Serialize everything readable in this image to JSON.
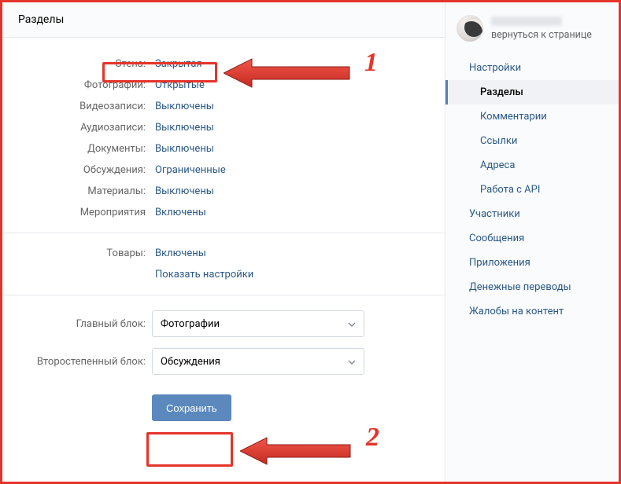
{
  "header": {
    "title": "Разделы"
  },
  "sections1": [
    {
      "label": "Стена:",
      "value": "Закрытая"
    },
    {
      "label": "Фотографии:",
      "value": "Открытые"
    },
    {
      "label": "Видеозаписи:",
      "value": "Выключены"
    },
    {
      "label": "Аудиозаписи:",
      "value": "Выключены"
    },
    {
      "label": "Документы:",
      "value": "Выключены"
    },
    {
      "label": "Обсуждения:",
      "value": "Ограниченные"
    },
    {
      "label": "Материалы:",
      "value": "Выключены"
    },
    {
      "label": "Мероприятия",
      "value": "Включены"
    }
  ],
  "sections2": {
    "goods": {
      "label": "Товары:",
      "value": "Включены"
    },
    "showSettings": "Показать настройки"
  },
  "blocks": {
    "main": {
      "label": "Главный блок:",
      "value": "Фотографии"
    },
    "secondary": {
      "label": "Второстепенный блок:",
      "value": "Обсуждения"
    }
  },
  "saveLabel": "Сохранить",
  "profile": {
    "backLink": "вернуться к странице"
  },
  "menu": [
    {
      "label": "Настройки",
      "sub": false,
      "active": false
    },
    {
      "label": "Разделы",
      "sub": true,
      "active": true
    },
    {
      "label": "Комментарии",
      "sub": true,
      "active": false
    },
    {
      "label": "Ссылки",
      "sub": true,
      "active": false
    },
    {
      "label": "Адреса",
      "sub": true,
      "active": false
    },
    {
      "label": "Работа с API",
      "sub": true,
      "active": false
    },
    {
      "label": "Участники",
      "sub": false,
      "active": false
    },
    {
      "label": "Сообщения",
      "sub": false,
      "active": false
    },
    {
      "label": "Приложения",
      "sub": false,
      "active": false
    },
    {
      "label": "Денежные переводы",
      "sub": false,
      "active": false
    },
    {
      "label": "Жалобы на контент",
      "sub": false,
      "active": false
    }
  ],
  "anno": {
    "num1": "1",
    "num2": "2"
  }
}
